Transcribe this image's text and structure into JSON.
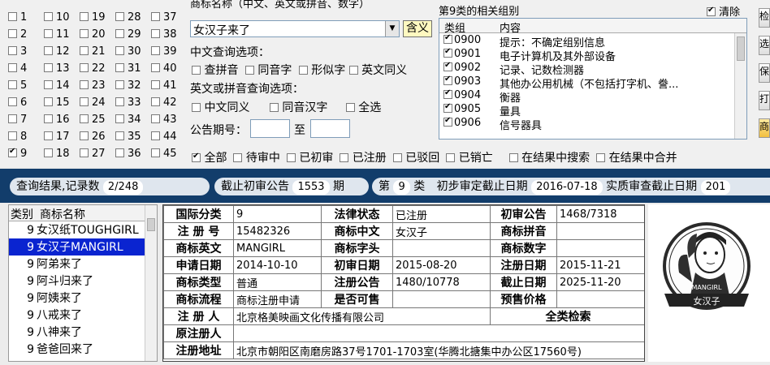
{
  "class_grid": [
    {
      "n": "1"
    },
    {
      "n": "2"
    },
    {
      "n": "3"
    },
    {
      "n": "4"
    },
    {
      "n": "5"
    },
    {
      "n": "6"
    },
    {
      "n": "7"
    },
    {
      "n": "8"
    },
    {
      "n": "9",
      "checked": true
    },
    {
      "n": "10"
    },
    {
      "n": "11"
    },
    {
      "n": "12"
    },
    {
      "n": "13"
    },
    {
      "n": "14"
    },
    {
      "n": "15"
    },
    {
      "n": "16"
    },
    {
      "n": "17"
    },
    {
      "n": "18"
    },
    {
      "n": "19"
    },
    {
      "n": "20"
    },
    {
      "n": "21"
    },
    {
      "n": "22"
    },
    {
      "n": "23"
    },
    {
      "n": "24"
    },
    {
      "n": "25"
    },
    {
      "n": "26"
    },
    {
      "n": "27"
    },
    {
      "n": "28"
    },
    {
      "n": "29"
    },
    {
      "n": "30"
    },
    {
      "n": "31"
    },
    {
      "n": "32"
    },
    {
      "n": "33"
    },
    {
      "n": "34"
    },
    {
      "n": "35"
    },
    {
      "n": "36"
    },
    {
      "n": "37"
    },
    {
      "n": "38"
    },
    {
      "n": "39"
    },
    {
      "n": "40"
    },
    {
      "n": "41"
    },
    {
      "n": "42"
    },
    {
      "n": "43"
    },
    {
      "n": "44"
    },
    {
      "n": "45"
    }
  ],
  "search": {
    "name_label": "商标名称（中文、英文或拼音、数字）",
    "name_value": "女汉子来了",
    "contains_button": "含义",
    "cn_options_label": "中文查询选项：",
    "cn_options": [
      "查拼音",
      "同音字",
      "形似字",
      "英文同义"
    ],
    "en_options_label": "英文或拼音查询选项：",
    "en_options": [
      "中文同义",
      "同音汉字",
      "全选"
    ],
    "issue_label": "公告期号：",
    "issue_to": "至",
    "issue_from_value": "",
    "issue_to_value": ""
  },
  "groups": {
    "title": "第9类的相关组别",
    "clear_label": "清除",
    "col_group": "类组",
    "col_content": "内容",
    "rows": [
      {
        "code": "0900",
        "text": "提示：不确定组别信息"
      },
      {
        "code": "0901",
        "text": "电子计算机及其外部设备"
      },
      {
        "code": "0902",
        "text": "记录、记数检测器"
      },
      {
        "code": "0903",
        "text": "其他办公用机械（不包括打字机、誊..."
      },
      {
        "code": "0904",
        "text": "衡器"
      },
      {
        "code": "0905",
        "text": "量具"
      },
      {
        "code": "0906",
        "text": "信号器具"
      }
    ]
  },
  "status_filters": [
    {
      "label": "全部",
      "checked": true
    },
    {
      "label": "待审中"
    },
    {
      "label": "已初审"
    },
    {
      "label": "已注册"
    },
    {
      "label": "已驳回"
    },
    {
      "label": "已销亡"
    },
    {
      "label": "在结果中搜索"
    },
    {
      "label": "在结果中合并"
    }
  ],
  "status_bar": {
    "result_label": "查询结果,记录数",
    "result_value": "2/248",
    "cutoff_label": "截止初审公告",
    "cutoff_value": "1553",
    "cutoff_unit": "期",
    "class_prefix": "第",
    "class_value": "9",
    "class_suffix": "类",
    "prelim_label": "初步审定截止日期",
    "prelim_value": "2016-07-18",
    "subst_label": "实质审查截止日期",
    "subst_value": "201"
  },
  "list": {
    "col_class": "类别",
    "col_name": "商标名称",
    "items": [
      {
        "c": "9",
        "name": "女汉纸TOUGHGIRL"
      },
      {
        "c": "9",
        "name": "女汉子MANGIRL",
        "selected": true
      },
      {
        "c": "9",
        "name": "阿弟来了"
      },
      {
        "c": "9",
        "name": "阿斗归来了"
      },
      {
        "c": "9",
        "name": "阿姨来了"
      },
      {
        "c": "9",
        "name": "八戒来了"
      },
      {
        "c": "9",
        "name": "八神来了"
      },
      {
        "c": "9",
        "name": "爸爸回来了"
      }
    ]
  },
  "detail": {
    "intl_class_k": "国际分类",
    "intl_class_v": "9",
    "legal_k": "法律状态",
    "legal_v": "已注册",
    "prelim_k": "初审公告",
    "prelim_v": "1468/7318",
    "regno_k": "注 册 号",
    "regno_v": "15482326",
    "cn_k": "商标中文",
    "cn_v": "女汉子",
    "pinyin_k": "商标拼音",
    "pinyin_v": "",
    "en_k": "商标英文",
    "en_v": "MANGIRL",
    "head_k": "商标字头",
    "head_v": "",
    "digit_k": "商标数字",
    "digit_v": "",
    "apply_k": "申请日期",
    "apply_v": "2014-10-10",
    "pdate_k": "初审日期",
    "pdate_v": "2015-08-20",
    "rdate_k": "注册日期",
    "rdate_v": "2015-11-21",
    "type_k": "商标类型",
    "type_v": "普通",
    "rnotice_k": "注册公告",
    "rnotice_v": "1480/10778",
    "expire_k": "截止日期",
    "expire_v": "2025-11-20",
    "flow_k": "商标流程",
    "flow_v": "商标注册申请",
    "sale_k": "是否可售",
    "sale_v": "",
    "presale_k": "预售价格",
    "presale_v": "",
    "owner_k": "注 册 人",
    "owner_v": "北京格美映画文化传播有限公司",
    "all_check": "全类检索",
    "orig_k": "原注册人",
    "orig_v": "",
    "addr_k": "注册地址",
    "addr_v": "北京市朝阳区南磨房路37号1701-1703室(华腾北搪集中办公区17560号)"
  },
  "logo": {
    "text": "MANGIRL",
    "banner": "女汉子"
  },
  "right_buttons": [
    "检",
    "选",
    "保",
    "打",
    "商"
  ]
}
